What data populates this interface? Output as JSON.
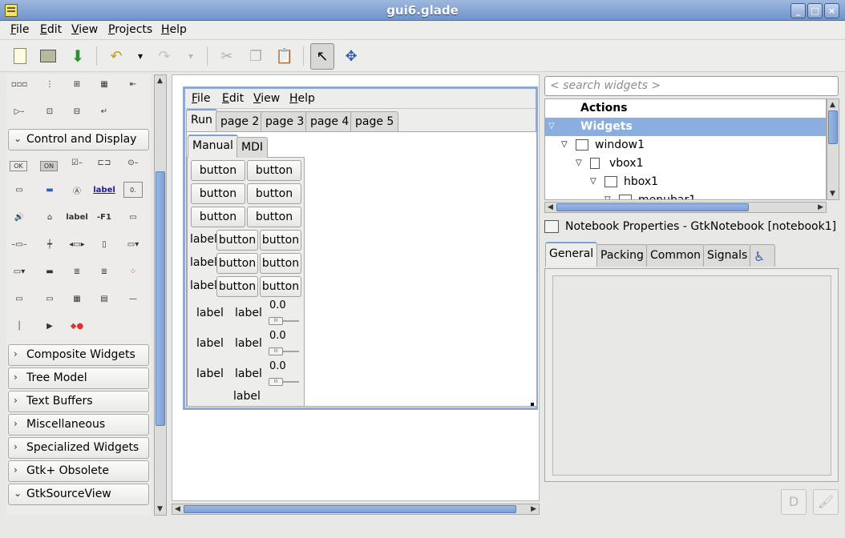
{
  "window": {
    "title": "gui6.glade"
  },
  "menubar": {
    "items": [
      "File",
      "Edit",
      "View",
      "Projects",
      "Help"
    ]
  },
  "palette": {
    "groups": [
      "Control and Display",
      "Composite Widgets",
      "Tree Model",
      "Text Buffers",
      "Miscellaneous",
      "Specialized Widgets",
      "Gtk+ Obsolete",
      "GtkSourceView"
    ],
    "icon_text": {
      "ok": "OK",
      "on": "ON",
      "label_link": "label",
      "label": "label",
      "f1": "-F1",
      "num": "0."
    }
  },
  "design": {
    "menu": [
      "File",
      "Edit",
      "View",
      "Help"
    ],
    "tabs": [
      "Run",
      "page 2",
      "page 3",
      "page 4",
      "page 5"
    ],
    "subtabs": [
      "Manual",
      "MDI"
    ],
    "button_label": "button",
    "label_text": "label",
    "slider_value": "0.0"
  },
  "search": {
    "placeholder": "< search widgets >"
  },
  "tree": {
    "rows": [
      {
        "label": "Actions",
        "selected": false
      },
      {
        "label": "Widgets",
        "selected": true
      },
      {
        "label": "window1",
        "selected": false
      },
      {
        "label": "vbox1",
        "selected": false
      },
      {
        "label": "hbox1",
        "selected": false
      },
      {
        "label": "menubar1",
        "selected": false
      }
    ]
  },
  "properties": {
    "title": "Notebook Properties - GtkNotebook [notebook1]",
    "tabs": [
      "General",
      "Packing",
      "Common",
      "Signals"
    ],
    "accessibility_icon": "accessibility-icon"
  },
  "colors": {
    "selection": "#8aaedf",
    "titlebar": "#7b9fd5",
    "accent": "#5d80b9"
  }
}
